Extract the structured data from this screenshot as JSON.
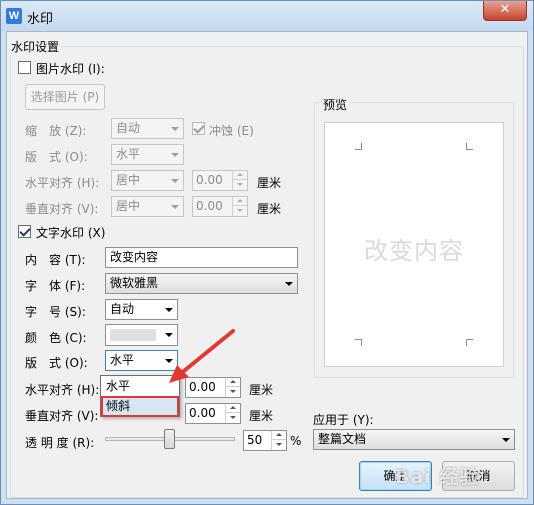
{
  "window": {
    "title": "水印",
    "close_glyph": "✕",
    "app_icon_letter": "W"
  },
  "group": {
    "title": "水印设置"
  },
  "picture": {
    "checkbox_label": "图片水印 (I):",
    "select_button": "选择图片 (P)",
    "scale_label": "缩　放 (Z):",
    "scale_value": "自动",
    "washout_label": "冲蚀 (E)",
    "layout_label": "版　式 (O):",
    "layout_value": "水平",
    "halign_label": "水平对齐 (H):",
    "halign_value": "居中",
    "halign_offset": "0.00",
    "valign_label": "垂直对齐 (V):",
    "valign_value": "居中",
    "valign_offset": "0.00",
    "unit": "厘米"
  },
  "text": {
    "checkbox_label": "文字水印 (X)",
    "content_label": "内　容 (T):",
    "content_value": "改变内容",
    "font_label": "字　体 (F):",
    "font_value": "微软雅黑",
    "size_label": "字　号 (S):",
    "size_value": "自动",
    "color_label": "颜　色 (C):",
    "layout_label": "版　式 (O):",
    "layout_value": "水平",
    "halign_label": "水平对齐 (H):",
    "halign_offset": "0.00",
    "valign_label": "垂直对齐 (V):",
    "valign_offset": "0.00",
    "unit": "厘米",
    "transparency_label": "透 明 度 (R):",
    "transparency_value": "50",
    "transparency_unit": "%"
  },
  "dropdown": {
    "items": [
      "水平",
      "倾斜"
    ]
  },
  "preview": {
    "label": "预览",
    "watermark_text": "改变内容"
  },
  "apply": {
    "label": "应用于 (Y):",
    "value": "整篇文档"
  },
  "buttons": {
    "ok": "确定",
    "cancel": "取消"
  },
  "overlay": {
    "watermark_brand": "Bai 经验"
  },
  "colors": {
    "annotation_red": "#e0392e",
    "preview_text": "#dadada"
  }
}
